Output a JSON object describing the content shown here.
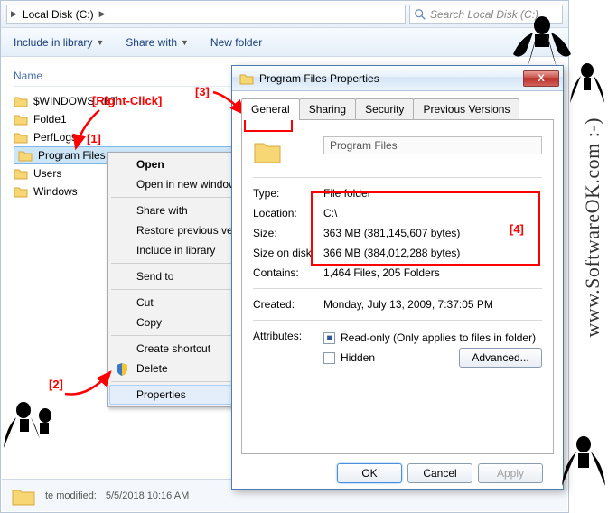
{
  "explorer": {
    "breadcrumb": {
      "part1": "Local Disk (C:)",
      "arrow": "▶"
    },
    "search_placeholder": "Search Local Disk (C:)",
    "toolbar": {
      "include": "Include in library",
      "share": "Share with",
      "newfolder": "New folder"
    },
    "column_header": "Name",
    "folders": [
      {
        "name": "$WINDOWS.~BT"
      },
      {
        "name": "Folde1"
      },
      {
        "name": "PerfLogs"
      },
      {
        "name": "Program Files"
      },
      {
        "name": "Users"
      },
      {
        "name": "Windows"
      }
    ],
    "status_modified": "5/5/2018 10:16 AM",
    "status_label": "te modified:"
  },
  "contextmenu": {
    "open": "Open",
    "open_new": "Open in new window",
    "share_with": "Share with",
    "restore": "Restore previous vers",
    "include": "Include in library",
    "send_to": "Send to",
    "cut": "Cut",
    "copy": "Copy",
    "shortcut": "Create shortcut",
    "delete": "Delete",
    "properties": "Properties"
  },
  "properties": {
    "title": "Program Files Properties",
    "close_x": "X",
    "tabs": {
      "general": "General",
      "sharing": "Sharing",
      "security": "Security",
      "previous": "Previous Versions"
    },
    "name": "Program Files",
    "labels": {
      "type": "Type:",
      "location": "Location:",
      "size": "Size:",
      "sizeondisk": "Size on disk:",
      "contains": "Contains:",
      "created": "Created:",
      "attributes": "Attributes:"
    },
    "values": {
      "type": "File folder",
      "location": "C:\\",
      "size": "363 MB (381,145,607 bytes)",
      "sizeondisk": "366 MB (384,012,288 bytes)",
      "contains": "1,464 Files, 205 Folders",
      "created": "Monday, July 13, 2009, 7:37:05 PM"
    },
    "readonly": "Read-only (Only applies to files in folder)",
    "hidden": "Hidden",
    "advanced": "Advanced...",
    "ok": "OK",
    "cancel": "Cancel",
    "apply": "Apply"
  },
  "annotations": {
    "rightclick": "[Right-Click]",
    "n1": "[1]",
    "n2": "[2]",
    "n3": "[3]",
    "n4": "[4]"
  },
  "watermark": "www.SoftwareOK.com :-)"
}
